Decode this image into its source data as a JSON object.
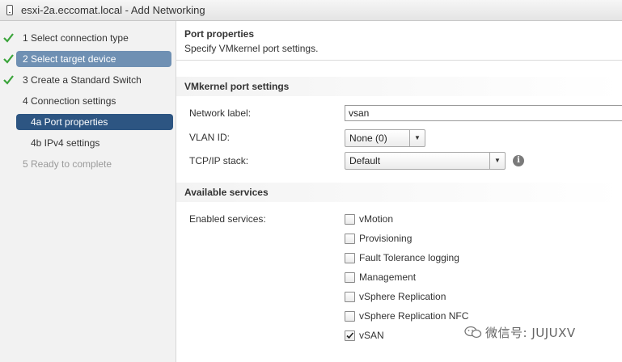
{
  "window": {
    "title": "esxi-2a.eccomat.local - Add Networking"
  },
  "steps": [
    {
      "label": "1  Select connection type",
      "state": "done"
    },
    {
      "label": "2  Select target device",
      "state": "done-selected"
    },
    {
      "label": "3  Create a Standard Switch",
      "state": "done"
    },
    {
      "label": "4  Connection settings",
      "state": "normal"
    },
    {
      "label": "4a  Port properties",
      "state": "current"
    },
    {
      "label": "4b  IPv4 settings",
      "state": "normal"
    },
    {
      "label": "5  Ready to complete",
      "state": "disabled"
    }
  ],
  "header": {
    "title": "Port properties",
    "subtitle": "Specify VMkernel port settings."
  },
  "vmk_section": {
    "title": "VMkernel port settings",
    "network_label": {
      "label": "Network label:",
      "value": "vsan"
    },
    "vlan_id": {
      "label": "VLAN ID:",
      "value": "None (0)"
    },
    "tcpip_stack": {
      "label": "TCP/IP stack:",
      "value": "Default"
    }
  },
  "services_section": {
    "title": "Available services",
    "enabled_label": "Enabled services:",
    "services": [
      {
        "label": "vMotion",
        "checked": false
      },
      {
        "label": "Provisioning",
        "checked": false
      },
      {
        "label": "Fault Tolerance logging",
        "checked": false
      },
      {
        "label": "Management",
        "checked": false
      },
      {
        "label": "vSphere Replication",
        "checked": false
      },
      {
        "label": "vSphere Replication NFC",
        "checked": false
      },
      {
        "label": "vSAN",
        "checked": true
      }
    ]
  },
  "watermark": {
    "text": "微信号: JUJUXV"
  },
  "icons": {
    "window": "host-icon",
    "done": "checkmark-icon",
    "info": "info-icon",
    "dropdown": "dropdown-arrow-icon",
    "watermark": "wechat-icon"
  },
  "colors": {
    "check_green": "#3aa43a",
    "selected_light": "#6f90b3",
    "selected_dark": "#2d5582"
  }
}
